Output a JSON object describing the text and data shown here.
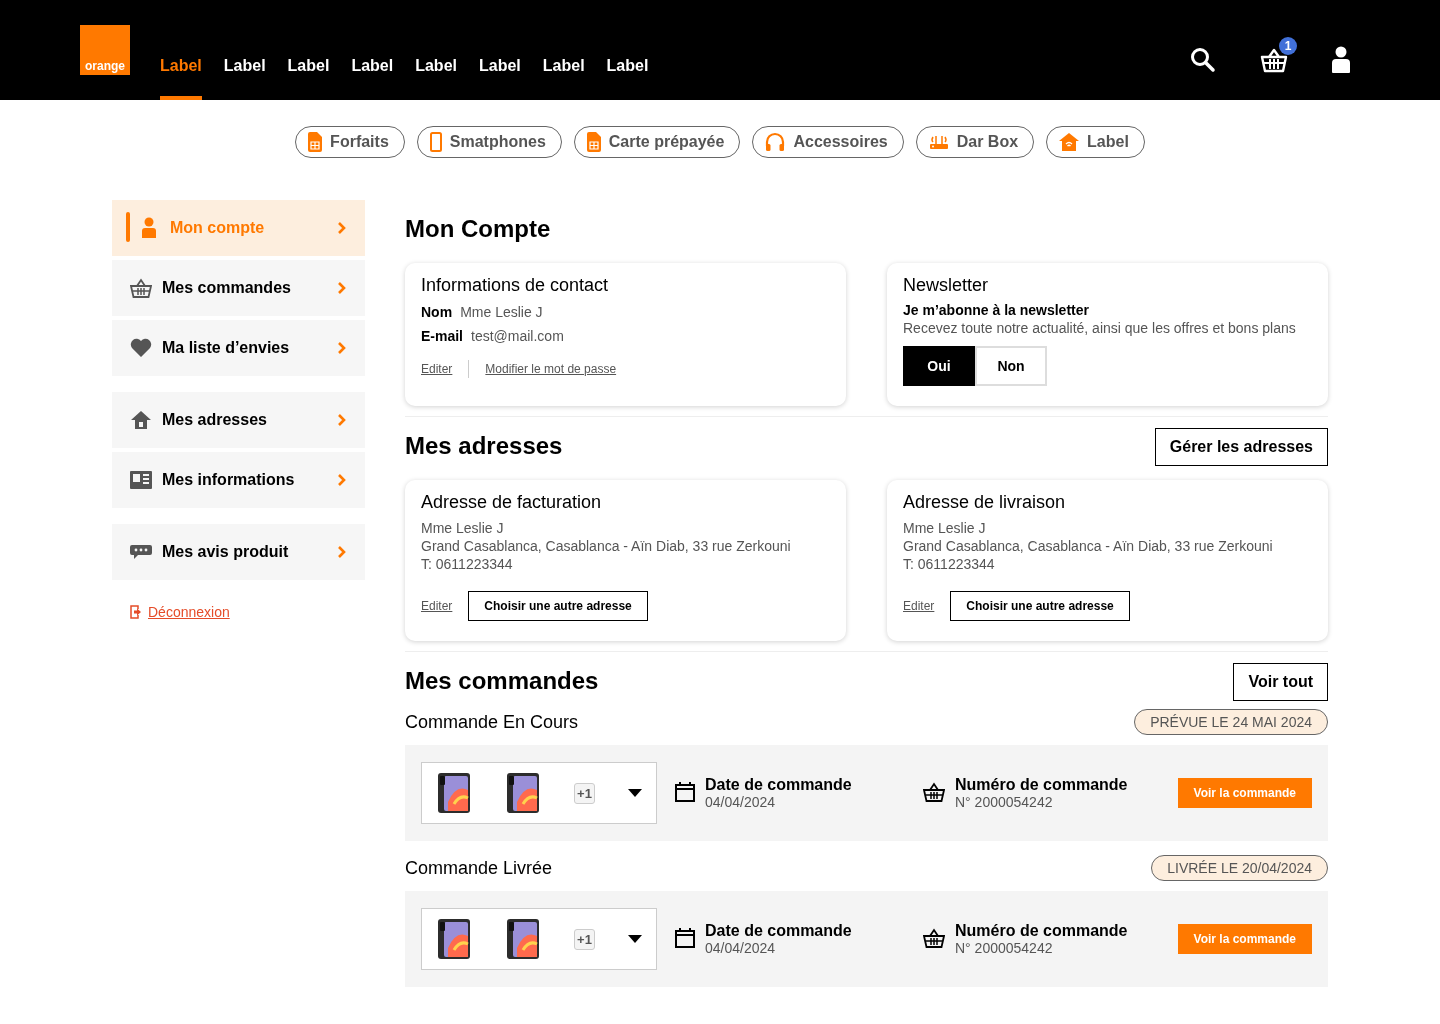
{
  "header": {
    "logo_text": "orange",
    "nav": [
      {
        "label": "Label",
        "selected": true
      },
      {
        "label": "Label",
        "selected": false
      },
      {
        "label": "Label",
        "selected": false
      },
      {
        "label": "Label",
        "selected": false
      },
      {
        "label": "Label",
        "selected": false
      },
      {
        "label": "Label",
        "selected": false
      },
      {
        "label": "Label",
        "selected": false
      },
      {
        "label": "Label",
        "selected": false
      }
    ],
    "cart_badge": "1"
  },
  "categories": [
    {
      "label": "Forfaits",
      "kind": "sim"
    },
    {
      "label": "Smatphones",
      "kind": "phone"
    },
    {
      "label": "Carte prépayée",
      "kind": "sim"
    },
    {
      "label": "Accessoires",
      "kind": "headphones"
    },
    {
      "label": "Dar Box",
      "kind": "router"
    },
    {
      "label": "Label",
      "kind": "home"
    }
  ],
  "sidebar": {
    "groups": [
      [
        {
          "label": "Mon compte",
          "kind": "user",
          "selected": true
        },
        {
          "label": "Mes commandes",
          "kind": "basket",
          "selected": false
        },
        {
          "label": "Ma liste d’envies",
          "kind": "heart",
          "selected": false
        }
      ],
      [
        {
          "label": "Mes adresses",
          "kind": "house",
          "selected": false
        },
        {
          "label": "Mes informations",
          "kind": "card",
          "selected": false
        }
      ],
      [
        {
          "label": "Mes avis produit",
          "kind": "review",
          "selected": false
        }
      ]
    ],
    "logout": "Déconnexion"
  },
  "account": {
    "title": "Mon Compte",
    "contact": {
      "title": "Informations de contact",
      "fields": [
        {
          "label": "Nom",
          "value": "Mme Leslie J"
        },
        {
          "label": "E-mail",
          "value": "test@mail.com"
        }
      ],
      "links": [
        "Editer",
        "Modifier le mot de passe"
      ]
    },
    "newsletter": {
      "title": "Newsletter",
      "heading": "Je m’abonne à la newsletter",
      "description": "Recevez toute notre actualité, ainsi que les offres et bons plans",
      "options": [
        {
          "label": "Oui",
          "selected": true
        },
        {
          "label": "Non",
          "selected": false
        }
      ]
    }
  },
  "addresses": {
    "title": "Mes adresses",
    "button": "Gérer les adresses",
    "cards": [
      {
        "title": "Adresse de facturation",
        "name": "Mme Leslie J",
        "address": "Grand Casablanca, Casablanca - Aïn Diab, 33 rue Zerkouni",
        "phone": "T: 0611223344",
        "edit_link": "Editer",
        "button": "Choisir une autre adresse"
      },
      {
        "title": "Adresse de livraison",
        "name": "Mme Leslie J",
        "address": "Grand Casablanca, Casablanca - Aïn Diab, 33 rue Zerkouni",
        "phone": "T: 0611223344",
        "edit_link": "Editer",
        "button": "Choisir une autre adresse"
      }
    ]
  },
  "orders": {
    "title": "Mes commandes",
    "button": "Voir tout",
    "sections": [
      {
        "title": "Commande En Cours",
        "status": "PRÉVUE LE 24 MAI 2024",
        "more": "+1",
        "date_label": "Date de commande",
        "date": "04/04/2024",
        "number_label": "Numéro de commande",
        "number": "N° 2000054242",
        "button": "Voir la commande"
      },
      {
        "title": "Commande Livrée",
        "status": "LIVRÉE LE 20/04/2024",
        "more": "+1",
        "date_label": "Date de commande",
        "date": "04/04/2024",
        "number_label": "Numéro de commande",
        "number": "N° 2000054242",
        "button": "Voir la commande"
      }
    ]
  }
}
